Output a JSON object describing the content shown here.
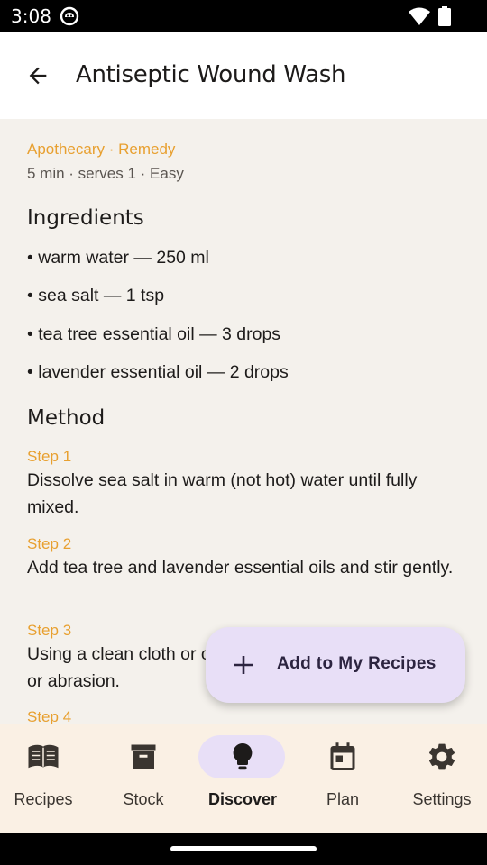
{
  "status": {
    "time": "3:08"
  },
  "header": {
    "title": "Antiseptic Wound Wash"
  },
  "recipe": {
    "category": "Apothecary · Remedy",
    "meta": "5 min · serves 1 · Easy",
    "ingredients_heading": "Ingredients",
    "ingredients": [
      "• warm water — 250 ml",
      "• sea salt — 1 tsp",
      "• tea tree essential oil — 3 drops",
      "• lavender essential oil — 2 drops"
    ],
    "method_heading": "Method",
    "steps": [
      {
        "label": "Step 1",
        "text": "Dissolve sea salt in warm (not hot) water until fully mixed."
      },
      {
        "label": "Step 2",
        "text": "Add tea tree and lavender essential oils and stir gently."
      },
      {
        "label": "Step 3",
        "text": "Using a clean cloth or cotton pad, gently cleanse the cut or abrasion."
      },
      {
        "label": "Step 4",
        "text": ""
      }
    ]
  },
  "fab": {
    "label": "Add to My Recipes",
    "icon": "plus-icon"
  },
  "nav": {
    "items": [
      {
        "label": "Recipes",
        "icon": "book-icon",
        "active": false
      },
      {
        "label": "Stock",
        "icon": "archive-box-icon",
        "active": false
      },
      {
        "label": "Discover",
        "icon": "lightbulb-icon",
        "active": true
      },
      {
        "label": "Plan",
        "icon": "calendar-icon",
        "active": false
      },
      {
        "label": "Settings",
        "icon": "gear-icon",
        "active": false
      }
    ]
  },
  "colors": {
    "accent": "#e8a030",
    "surface": "#f4f1ec",
    "fab_background": "#e8dff7",
    "nav_background": "#faf0e4"
  }
}
